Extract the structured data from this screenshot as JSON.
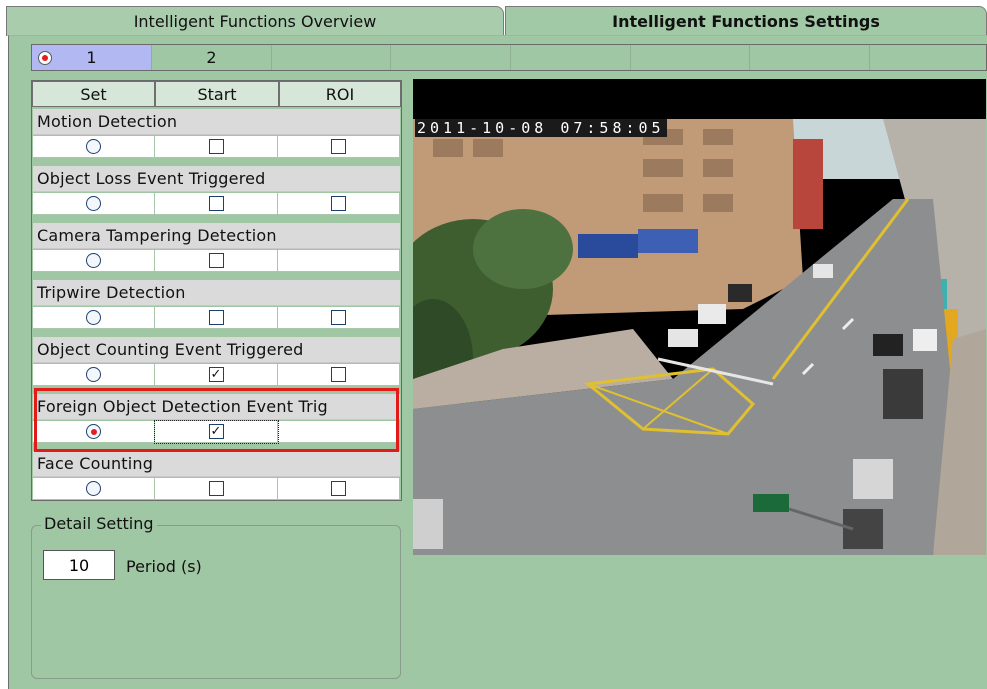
{
  "tabs": [
    {
      "label": "Intelligent Functions Overview",
      "active": false
    },
    {
      "label": "Intelligent Functions Settings",
      "active": true
    }
  ],
  "channels": [
    {
      "label": "1",
      "selected": true
    },
    {
      "label": "2",
      "selected": false
    }
  ],
  "table": {
    "headers": {
      "set": "Set",
      "start": "Start",
      "roi": "ROI"
    },
    "rows": [
      {
        "name": "Motion Detection",
        "set": false,
        "start": false,
        "roi": true
      },
      {
        "name": "Object Loss Event Triggered",
        "set": false,
        "start": false,
        "roi": true
      },
      {
        "name": "Camera Tampering Detection",
        "set": false,
        "start": false,
        "roi": null
      },
      {
        "name": "Tripwire Detection",
        "set": false,
        "start": false,
        "roi": true
      },
      {
        "name": "Object Counting Event Triggered",
        "set": false,
        "start": true,
        "roi": true
      },
      {
        "name": "Foreign Object Detection Event Trig",
        "set": true,
        "start": true,
        "roi": null
      },
      {
        "name": "Face Counting",
        "set": false,
        "start": false,
        "roi": true
      }
    ]
  },
  "detail": {
    "legend": "Detail Setting",
    "period_value": "10",
    "period_label": "Period (s)"
  },
  "camera": {
    "timestamp": "2011-10-08 07:58:05"
  },
  "colors": {
    "panel_bg": "#a0c7a4",
    "highlight": "#e21a1a",
    "selected_channel": "#b2b8f2"
  }
}
